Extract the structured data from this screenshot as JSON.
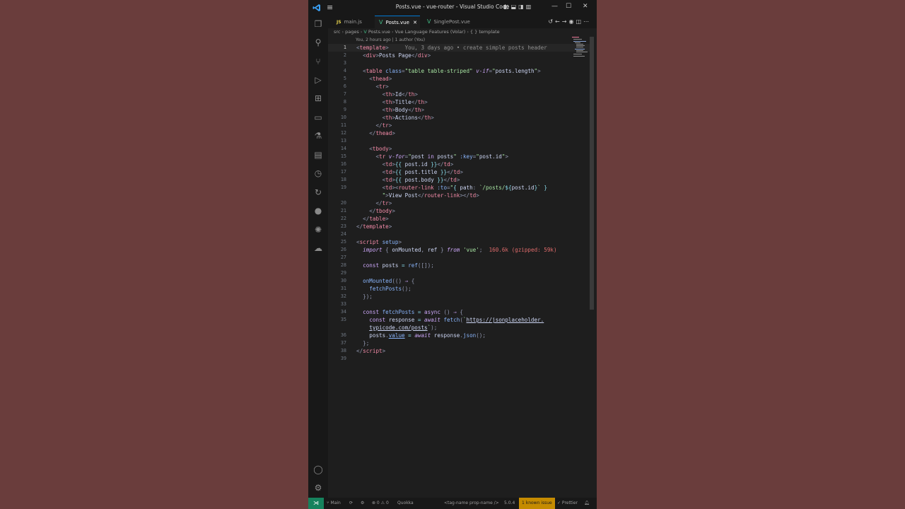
{
  "window": {
    "title": "Posts.vue - vue-router - Visual Studio Code"
  },
  "tabs": [
    {
      "label": "main.js",
      "icon": "js-file-icon"
    },
    {
      "label": "Posts.vue",
      "icon": "vue-file-icon",
      "active": true,
      "close": "✕"
    },
    {
      "label": "SinglePost.vue",
      "icon": "vue-file-icon"
    }
  ],
  "breadcrumb": {
    "items": [
      "src",
      "pages",
      "Posts.vue",
      "Vue Language Features (Volar)",
      "{ } template"
    ]
  },
  "codelens": "You, 2 hours ago | 1 author (You)",
  "blame": "You, 3 days ago • create simple posts header",
  "import_cost": "160.6k (gzipped: 59k)",
  "line_numbers": [
    "1",
    "2",
    "3",
    "4",
    "5",
    "6",
    "7",
    "8",
    "9",
    "10",
    "11",
    "12",
    "13",
    "14",
    "15",
    "16",
    "17",
    "18",
    "19",
    "",
    "20",
    "21",
    "22",
    "23",
    "24",
    "25",
    "26",
    "27",
    "28",
    "29",
    "30",
    "31",
    "32",
    "33",
    "34",
    "35",
    "",
    "36",
    "37",
    "38",
    "39"
  ],
  "status": {
    "branch": "Main",
    "problems": "⊗ 0 ⚠ 0",
    "quokka": "Quokka",
    "tag": "<tag-name prop-name />",
    "version": "5.0.4",
    "issue": "1 known issue",
    "prettier": "✓ Prettier"
  },
  "colors": {
    "accent": "#0078d4",
    "vue": "#41b883",
    "remote": "#16825d",
    "issue": "#c58b00"
  }
}
